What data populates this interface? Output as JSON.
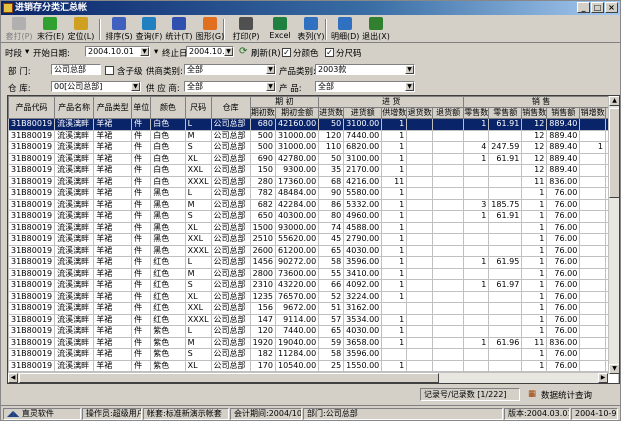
{
  "window": {
    "title": "进销存分类汇总帐",
    "min": "_",
    "max": "□",
    "close": "×"
  },
  "toolbar": [
    {
      "label": "套打(P)",
      "icon": "print-template-icon",
      "color": "#b0b0b0",
      "disabled": true
    },
    {
      "label": "末行(E)",
      "icon": "last-row-icon",
      "color": "#30a030"
    },
    {
      "label": "定位(L)",
      "icon": "locate-icon",
      "color": "#d0a020"
    },
    {
      "label": "排序(S)",
      "icon": "sort-icon",
      "color": "#4060c0"
    },
    {
      "label": "查询(F)",
      "icon": "query-icon",
      "color": "#2080c0"
    },
    {
      "label": "统计(T)",
      "icon": "statistics-icon",
      "color": "#3050b0"
    },
    {
      "label": "图形(G)",
      "icon": "chart-icon",
      "color": "#e07020"
    },
    {
      "label": "打印(P)",
      "icon": "printer-icon",
      "color": "#505050"
    },
    {
      "label": "Excel",
      "icon": "excel-icon",
      "color": "#208040"
    },
    {
      "label": "表列(Y)",
      "icon": "columns-icon",
      "color": "#3070c0"
    },
    {
      "label": "明细(D)",
      "icon": "detail-icon",
      "color": "#3070c0"
    },
    {
      "label": "退出(X)",
      "icon": "exit-icon",
      "color": "#308030"
    }
  ],
  "filters": {
    "period_label": "时段",
    "start_label": "开始日期:",
    "start_date": "2004.10.01",
    "end_label": "终止日期:",
    "end_date": "2004.10.31",
    "refresh_label": "刷新(R)",
    "by_color_label": "分颜色",
    "by_size_label": "分尺码",
    "dept_label": "部  门:",
    "dept_value": "公司总部",
    "include_sub_label": "含子级",
    "supplier_type_label": "供商类别:",
    "supplier_type_value": "全部",
    "product_type_label": "产品类别:",
    "product_type_value": "2003款",
    "warehouse_label": "仓  库:",
    "warehouse_value": "00[公司总部]",
    "supplier_label": "供 应 商:",
    "supplier_value": "全部",
    "product_label": "产  品:",
    "product_value": "全部"
  },
  "table": {
    "group_headers": {
      "opening": "期 初",
      "purchase": "进 货",
      "sales": "销 售"
    },
    "columns": [
      "产品代码",
      "产品名称",
      "产品类型",
      "单位",
      "颜色",
      "尺码",
      "仓库",
      "期初数",
      "期初金额",
      "进货数",
      "进货额",
      "供增数",
      "退货数",
      "退货额",
      "零售数",
      "零售额",
      "销售数",
      "销售额",
      "销增数",
      "退"
    ],
    "rows": [
      [
        "31B80019",
        "流溪漓畔",
        "羊裙",
        "件",
        "白色",
        "L",
        "公司总部",
        "680",
        "42160.00",
        "50",
        "3100.00",
        "1",
        "",
        "",
        "1",
        "61.91",
        "12",
        "889.40",
        "",
        ""
      ],
      [
        "31B80019",
        "流溪漓畔",
        "羊裙",
        "件",
        "白色",
        "M",
        "公司总部",
        "500",
        "31000.00",
        "120",
        "7440.00",
        "1",
        "",
        "",
        "",
        "",
        "12",
        "889.40",
        "",
        ""
      ],
      [
        "31B80019",
        "流溪漓畔",
        "羊裙",
        "件",
        "白色",
        "S",
        "公司总部",
        "500",
        "31000.00",
        "110",
        "6820.00",
        "1",
        "",
        "",
        "4",
        "247.59",
        "12",
        "889.40",
        "1",
        "-4"
      ],
      [
        "31B80019",
        "流溪漓畔",
        "羊裙",
        "件",
        "白色",
        "XL",
        "公司总部",
        "690",
        "42780.00",
        "50",
        "3100.00",
        "1",
        "",
        "",
        "1",
        "61.91",
        "12",
        "889.40",
        "",
        ""
      ],
      [
        "31B80019",
        "流溪漓畔",
        "羊裙",
        "件",
        "白色",
        "XXL",
        "公司总部",
        "150",
        "9300.00",
        "35",
        "2170.00",
        "1",
        "",
        "",
        "",
        "",
        "12",
        "889.40",
        "",
        ""
      ],
      [
        "31B80019",
        "流溪漓畔",
        "羊裙",
        "件",
        "白色",
        "XXXL",
        "公司总部",
        "280",
        "17360.00",
        "68",
        "4216.00",
        "11",
        "",
        "",
        "",
        "",
        "11",
        "836.00",
        "",
        ""
      ],
      [
        "31B80019",
        "流溪漓畔",
        "羊裙",
        "件",
        "黑色",
        "L",
        "公司总部",
        "782",
        "48484.00",
        "90",
        "5580.00",
        "1",
        "",
        "",
        "",
        "",
        "1",
        "76.00",
        "",
        ""
      ],
      [
        "31B80019",
        "流溪漓畔",
        "羊裙",
        "件",
        "黑色",
        "M",
        "公司总部",
        "682",
        "42284.00",
        "86",
        "5332.00",
        "1",
        "",
        "",
        "3",
        "185.75",
        "1",
        "76.00",
        "",
        ""
      ],
      [
        "31B80019",
        "流溪漓畔",
        "羊裙",
        "件",
        "黑色",
        "S",
        "公司总部",
        "650",
        "40300.00",
        "80",
        "4960.00",
        "1",
        "",
        "",
        "1",
        "61.91",
        "1",
        "76.00",
        "",
        ""
      ],
      [
        "31B80019",
        "流溪漓畔",
        "羊裙",
        "件",
        "黑色",
        "XL",
        "公司总部",
        "1500",
        "93000.00",
        "74",
        "4588.00",
        "1",
        "",
        "",
        "",
        "",
        "1",
        "76.00",
        "",
        ""
      ],
      [
        "31B80019",
        "流溪漓畔",
        "羊裙",
        "件",
        "黑色",
        "XXL",
        "公司总部",
        "2510",
        "55620.00",
        "45",
        "2790.00",
        "1",
        "",
        "",
        "",
        "",
        "1",
        "76.00",
        "",
        ""
      ],
      [
        "31B80019",
        "流溪漓畔",
        "羊裙",
        "件",
        "黑色",
        "XXXL",
        "公司总部",
        "2600",
        "61200.00",
        "65",
        "4030.00",
        "1",
        "",
        "",
        "",
        "",
        "1",
        "76.00",
        "",
        ""
      ],
      [
        "31B80019",
        "流溪漓畔",
        "羊裙",
        "件",
        "红色",
        "L",
        "公司总部",
        "1456",
        "90272.00",
        "58",
        "3596.00",
        "1",
        "",
        "",
        "1",
        "61.95",
        "1",
        "76.00",
        "",
        ""
      ],
      [
        "31B80019",
        "流溪漓畔",
        "羊裙",
        "件",
        "红色",
        "M",
        "公司总部",
        "2800",
        "73600.00",
        "55",
        "3410.00",
        "1",
        "",
        "",
        "",
        "",
        "1",
        "76.00",
        "",
        ""
      ],
      [
        "31B80019",
        "流溪漓畔",
        "羊裙",
        "件",
        "红色",
        "S",
        "公司总部",
        "2310",
        "43220.00",
        "66",
        "4092.00",
        "1",
        "",
        "",
        "1",
        "61.97",
        "1",
        "76.00",
        "",
        ""
      ],
      [
        "31B80019",
        "流溪漓畔",
        "羊裙",
        "件",
        "红色",
        "XL",
        "公司总部",
        "1235",
        "76570.00",
        "52",
        "3224.00",
        "1",
        "",
        "",
        "",
        "",
        "1",
        "76.00",
        "",
        ""
      ],
      [
        "31B80019",
        "流溪漓畔",
        "羊裙",
        "件",
        "红色",
        "XXL",
        "公司总部",
        "156",
        "9672.00",
        "51",
        "3162.00",
        "",
        "",
        "",
        "",
        "",
        "1",
        "76.00",
        "",
        ""
      ],
      [
        "31B80019",
        "流溪漓畔",
        "羊裙",
        "件",
        "红色",
        "XXXL",
        "公司总部",
        "147",
        "9114.00",
        "57",
        "3534.00",
        "1",
        "",
        "",
        "",
        "",
        "1",
        "76.00",
        "",
        ""
      ],
      [
        "31B80019",
        "流溪漓畔",
        "羊裙",
        "件",
        "紫色",
        "L",
        "公司总部",
        "120",
        "7440.00",
        "65",
        "4030.00",
        "1",
        "",
        "",
        "",
        "",
        "1",
        "76.00",
        "",
        ""
      ],
      [
        "31B80019",
        "流溪漓畔",
        "羊裙",
        "件",
        "紫色",
        "M",
        "公司总部",
        "1920",
        "19040.00",
        "59",
        "3658.00",
        "1",
        "",
        "",
        "1",
        "61.96",
        "11",
        "836.00",
        "",
        ""
      ],
      [
        "31B80019",
        "流溪漓畔",
        "羊裙",
        "件",
        "紫色",
        "S",
        "公司总部",
        "182",
        "11284.00",
        "58",
        "3596.00",
        "",
        "",
        "",
        "",
        "",
        "1",
        "76.00",
        "",
        ""
      ],
      [
        "31B80019",
        "流溪漓畔",
        "羊裙",
        "件",
        "紫色",
        "XL",
        "公司总部",
        "170",
        "10540.00",
        "25",
        "1550.00",
        "1",
        "",
        "",
        "",
        "",
        "1",
        "76.00",
        "",
        ""
      ],
      [
        "31B80019",
        "流溪漓畔",
        "羊裙",
        "件",
        "紫色",
        "XXL",
        "公司总部",
        "150",
        "9300.00",
        "24",
        "1488.00",
        "1",
        "",
        "",
        "",
        "",
        "1",
        "76.00",
        "",
        ""
      ]
    ]
  },
  "recbar": {
    "record_label": "记录号/记录数 [1/222]",
    "stats_label": "数据统计查询"
  },
  "status": {
    "company": "直灵软件",
    "operator": "操作员:超级用户",
    "account": "帐套:标准新演示帐套",
    "period": "会计期间:2004/10",
    "dept": "部门:公司总部",
    "version": "版本:2004.03.014",
    "date": "2004-10-9"
  }
}
